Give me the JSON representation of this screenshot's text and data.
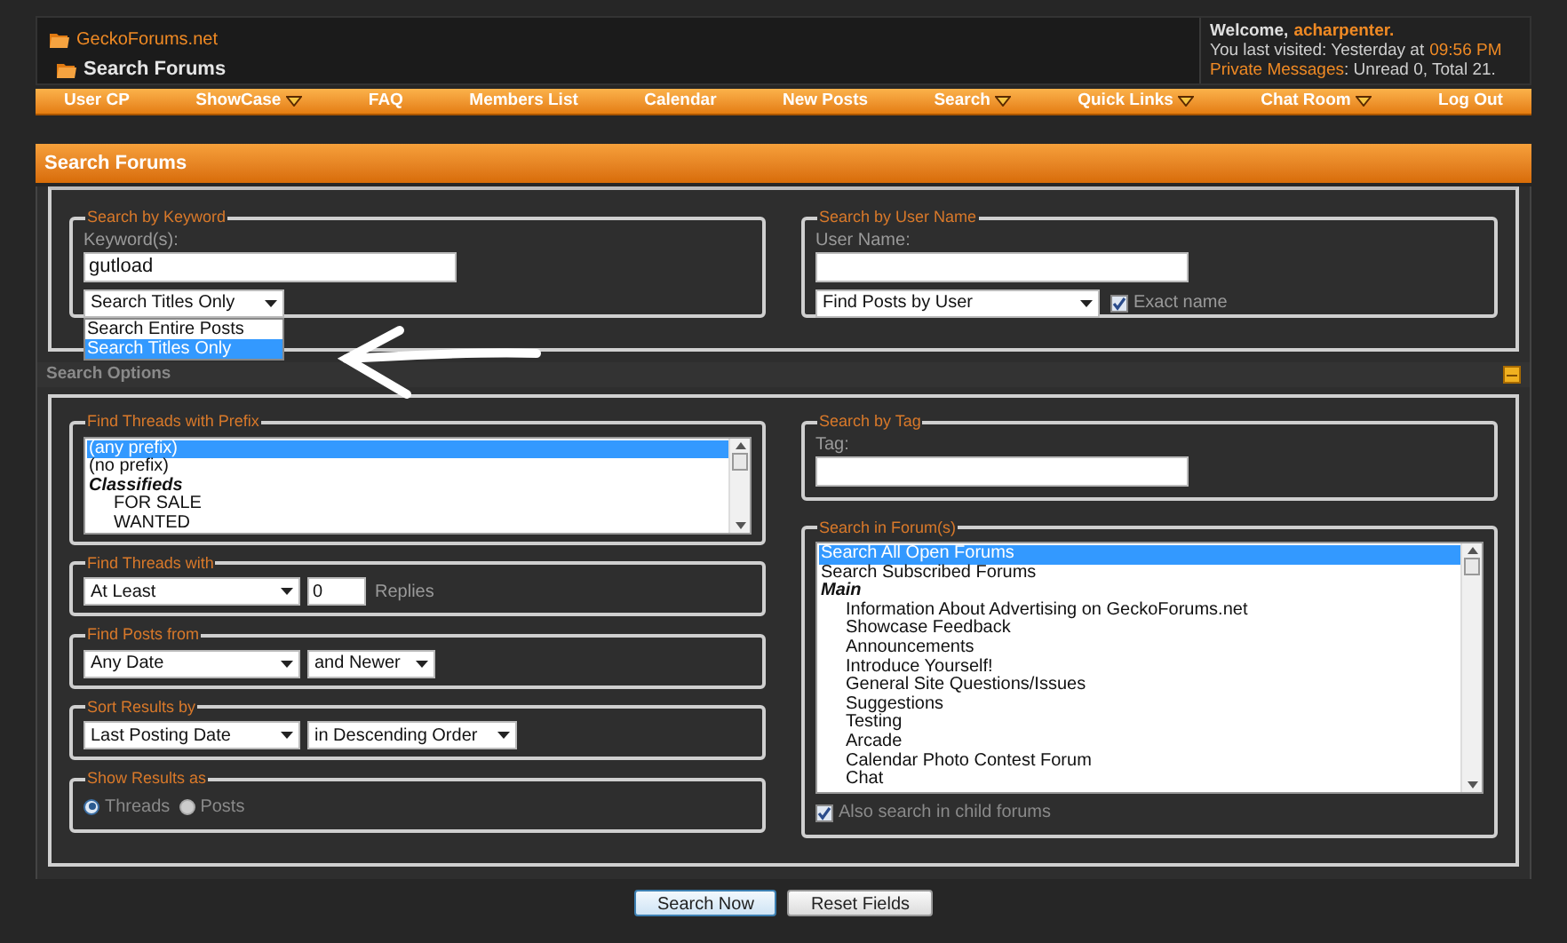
{
  "header": {
    "site_link": "GeckoForums.net",
    "page_title": "Search Forums",
    "welcome": {
      "greeting": "Welcome,",
      "user": "acharpenter.",
      "last_visited": "You last visited: Yesterday at",
      "time": "09:56 PM",
      "pm_label": "Private Messages",
      "pm_counts": ": Unread 0, Total 21."
    }
  },
  "nav": [
    {
      "label": "User CP",
      "has_menu": false
    },
    {
      "label": "ShowCase",
      "has_menu": true
    },
    {
      "label": "FAQ",
      "has_menu": false
    },
    {
      "label": "Members List",
      "has_menu": false
    },
    {
      "label": "Calendar",
      "has_menu": false
    },
    {
      "label": "New Posts",
      "has_menu": false
    },
    {
      "label": "Search",
      "has_menu": true
    },
    {
      "label": "Quick Links",
      "has_menu": true
    },
    {
      "label": "Chat Room",
      "has_menu": true
    },
    {
      "label": "Log Out",
      "has_menu": false
    }
  ],
  "panel_title": "Search Forums",
  "keyword": {
    "legend": "Search by Keyword",
    "label": "Keyword(s):",
    "value": "gutload",
    "select": "Search Titles Only",
    "options": [
      {
        "label": "Search Entire Posts",
        "selected": false
      },
      {
        "label": "Search Titles Only",
        "selected": true
      }
    ]
  },
  "user_name": {
    "legend": "Search by User Name",
    "label": "User Name:",
    "select": "Find Posts by User",
    "exact": {
      "label": "Exact name",
      "checked": true
    }
  },
  "options_title": "Search Options",
  "prefix": {
    "legend": "Find Threads with Prefix",
    "items": [
      {
        "label": "(any prefix)",
        "kind": "option",
        "selected": true
      },
      {
        "label": "(no prefix)",
        "kind": "option",
        "selected": false
      },
      {
        "label": "Classifieds",
        "kind": "group",
        "selected": false
      },
      {
        "label": "FOR SALE",
        "kind": "child",
        "selected": false
      },
      {
        "label": "WANTED",
        "kind": "child",
        "selected": false
      }
    ]
  },
  "threads_with": {
    "legend": "Find Threads with",
    "select": "At Least",
    "value": "0",
    "suffix": "Replies"
  },
  "posts_from": {
    "legend": "Find Posts from",
    "select": "Any Date",
    "select_2": "and Newer"
  },
  "sort": {
    "legend": "Sort Results by",
    "select": "Last Posting Date",
    "select_2": "in Descending Order"
  },
  "show_as": {
    "legend": "Show Results as",
    "options": [
      {
        "label": "Threads",
        "selected": true
      },
      {
        "label": "Posts",
        "selected": false
      }
    ]
  },
  "tag": {
    "legend": "Search by Tag",
    "label": "Tag:"
  },
  "forums": {
    "legend": "Search in Forum(s)",
    "items": [
      {
        "label": "Search All Open Forums",
        "kind": "option",
        "selected": true
      },
      {
        "label": "Search Subscribed Forums",
        "kind": "option",
        "selected": false
      },
      {
        "label": "Main",
        "kind": "group",
        "selected": false
      },
      {
        "label": "Information About Advertising on GeckoForums.net",
        "kind": "child",
        "selected": false
      },
      {
        "label": "Showcase Feedback",
        "kind": "child",
        "selected": false
      },
      {
        "label": "Announcements",
        "kind": "child",
        "selected": false
      },
      {
        "label": "Introduce Yourself!",
        "kind": "child",
        "selected": false
      },
      {
        "label": "General Site Questions/Issues",
        "kind": "child",
        "selected": false
      },
      {
        "label": "Suggestions",
        "kind": "child",
        "selected": false
      },
      {
        "label": "Testing",
        "kind": "child",
        "selected": false
      },
      {
        "label": "Arcade",
        "kind": "child",
        "selected": false
      },
      {
        "label": "Calendar Photo Contest Forum",
        "kind": "child",
        "selected": false
      },
      {
        "label": "Chat",
        "kind": "child",
        "selected": false
      }
    ],
    "child": {
      "label": "Also search in child forums",
      "checked": true
    }
  },
  "buttons": [
    {
      "label": "Search Now",
      "kind": "primary"
    },
    {
      "label": "Reset Fields",
      "kind": "secondary"
    }
  ]
}
